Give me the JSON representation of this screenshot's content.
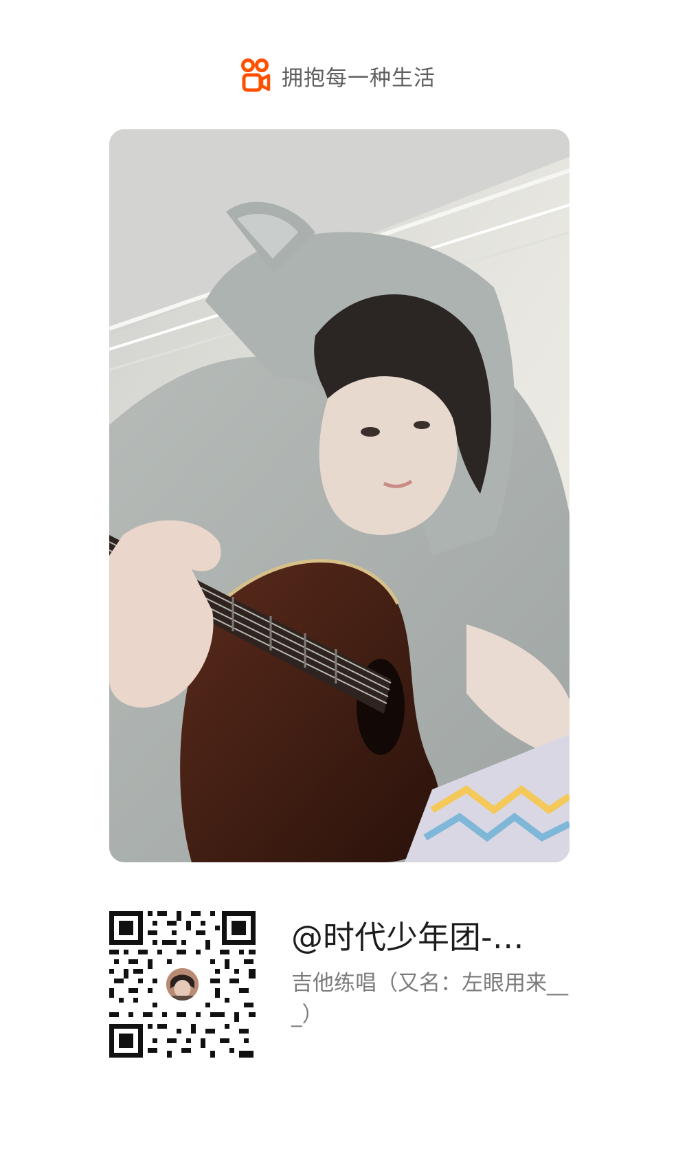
{
  "header": {
    "logo_icon": "kuaishou-logo-icon",
    "slogan": "拥抱每一种生活",
    "brand_color": "#ff5000"
  },
  "photo": {
    "description_icon": "video-cover-image"
  },
  "share": {
    "qr_icon": "qr-code-icon",
    "author": "@时代少年团-…",
    "caption": "吉他练唱（又名：左眼用来___）"
  }
}
